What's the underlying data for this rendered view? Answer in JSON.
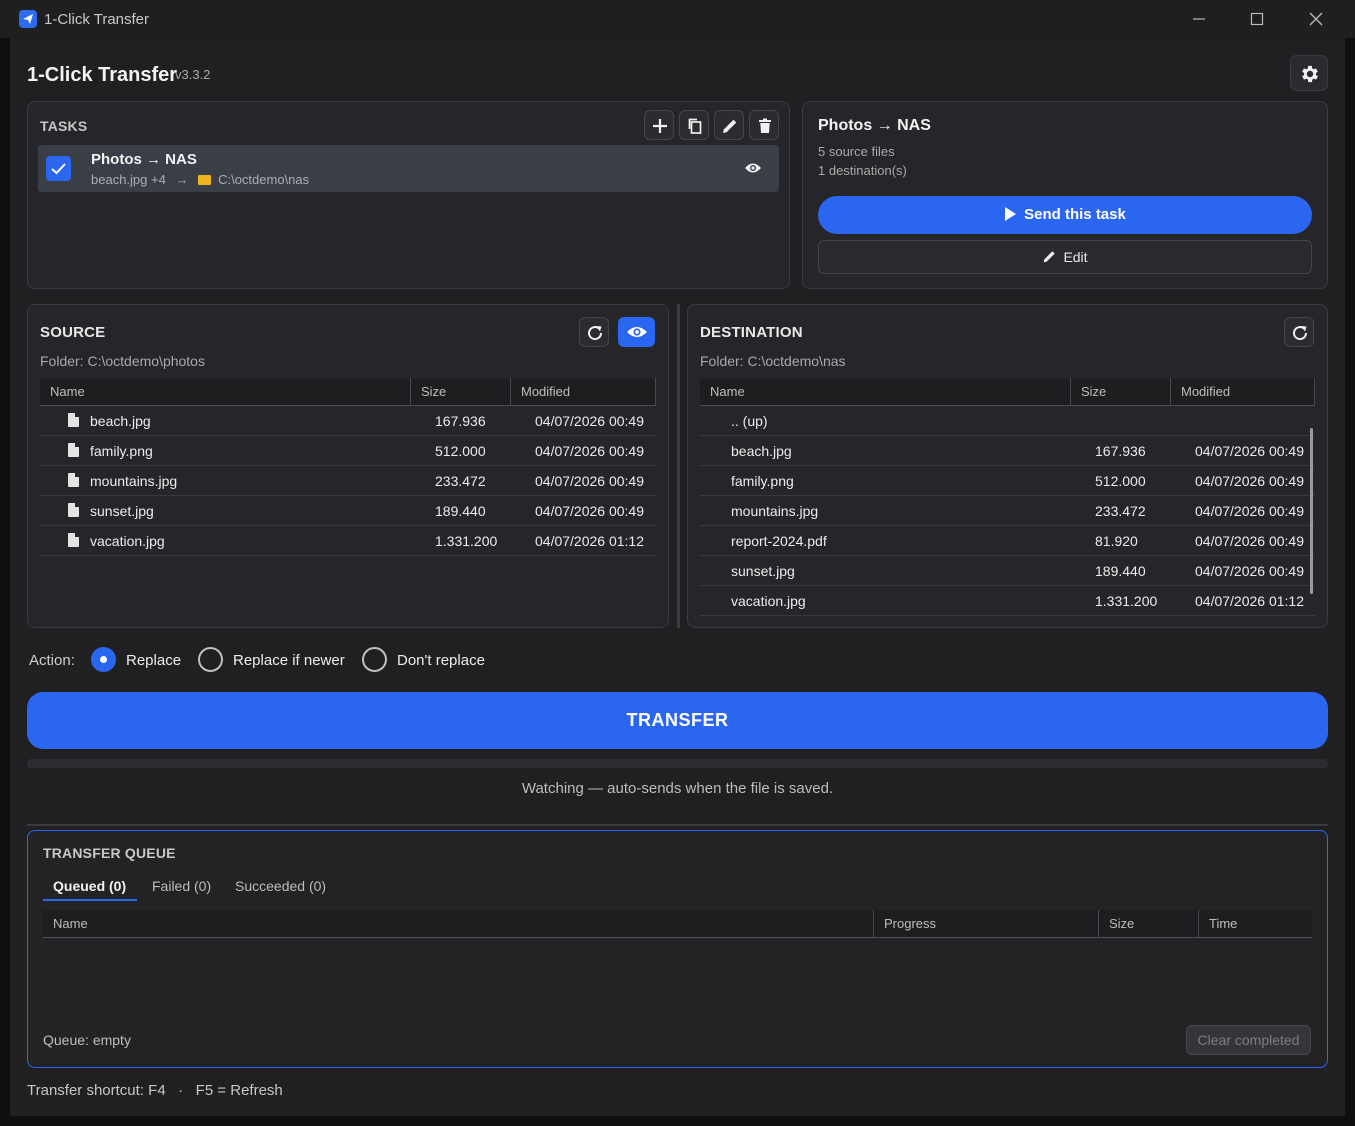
{
  "window": {
    "title": "1-Click Transfer"
  },
  "header": {
    "title": "1-Click Transfer",
    "version": "v3.3.2"
  },
  "tasks": {
    "label": "TASKS",
    "items": [
      {
        "name": "Photos → NAS",
        "source": "beach.jpg +4",
        "arrow": "→",
        "destination": "C:\\octdemo\\nas",
        "checked": true
      }
    ]
  },
  "task_detail": {
    "title": "Photos → NAS",
    "source_count": "5 source files",
    "destination_count": "1 destination(s)",
    "send_label": "Send this task",
    "edit_label": "Edit"
  },
  "source": {
    "label": "SOURCE",
    "folder": "Folder: C:\\octdemo\\photos",
    "columns": [
      "Name",
      "Size",
      "Modified"
    ],
    "rows": [
      {
        "name": "beach.jpg",
        "size": "167.936",
        "modified": "04/07/2026 00:49"
      },
      {
        "name": "family.png",
        "size": "512.000",
        "modified": "04/07/2026 00:49"
      },
      {
        "name": "mountains.jpg",
        "size": "233.472",
        "modified": "04/07/2026 00:49"
      },
      {
        "name": "sunset.jpg",
        "size": "189.440",
        "modified": "04/07/2026 00:49"
      },
      {
        "name": "vacation.jpg",
        "size": "1.331.200",
        "modified": "04/07/2026 01:12"
      }
    ]
  },
  "destination": {
    "label": "DESTINATION",
    "folder": "Folder: C:\\octdemo\\nas",
    "columns": [
      "Name",
      "Size",
      "Modified"
    ],
    "up_label": "..  (up)",
    "rows": [
      {
        "name": "beach.jpg",
        "size": "167.936",
        "modified": "04/07/2026 00:49"
      },
      {
        "name": "family.png",
        "size": "512.000",
        "modified": "04/07/2026 00:49"
      },
      {
        "name": "mountains.jpg",
        "size": "233.472",
        "modified": "04/07/2026 00:49"
      },
      {
        "name": "report-2024.pdf",
        "size": "81.920",
        "modified": "04/07/2026 00:49"
      },
      {
        "name": "sunset.jpg",
        "size": "189.440",
        "modified": "04/07/2026 00:49"
      },
      {
        "name": "vacation.jpg",
        "size": "1.331.200",
        "modified": "04/07/2026 01:12"
      }
    ]
  },
  "action": {
    "label": "Action:",
    "options": [
      {
        "label": "Replace",
        "selected": true
      },
      {
        "label": "Replace if newer",
        "selected": false
      },
      {
        "label": "Don't replace",
        "selected": false
      }
    ]
  },
  "transfer": {
    "label": "TRANSFER",
    "progress": 0,
    "status": "Watching — auto-sends when the file is saved."
  },
  "queue": {
    "label": "TRANSFER QUEUE",
    "tabs": [
      "Queued (0)",
      "Failed (0)",
      "Succeeded (0)"
    ],
    "columns": [
      "Name",
      "Progress",
      "Size",
      "Time"
    ],
    "status": "Queue: empty",
    "clear_label": "Clear completed"
  },
  "footer": {
    "text": "Transfer shortcut: F4   ·   F5 = Refresh"
  },
  "colors": {
    "accent": "#2a66f0",
    "folder": "#f3b51f",
    "background": "#202023",
    "panel": "#26262a"
  },
  "icons": [
    "app-icon",
    "minimize-icon",
    "maximize-icon",
    "close-icon",
    "gear-icon",
    "plus-icon",
    "copy-icon",
    "pencil-icon",
    "trash-icon",
    "check-icon",
    "folder-icon",
    "eye-icon",
    "refresh-icon",
    "file-icon",
    "play-icon"
  ]
}
